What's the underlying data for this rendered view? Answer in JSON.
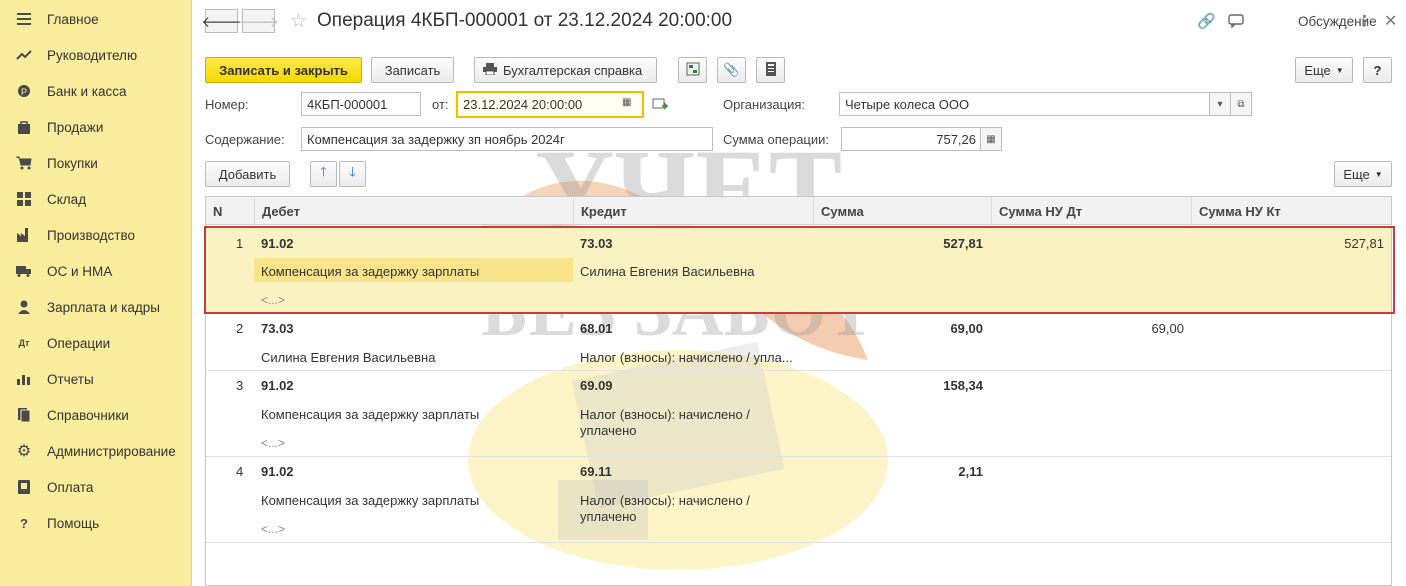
{
  "sidebar": {
    "items": [
      {
        "label": "Главное",
        "icon": "menu-icon"
      },
      {
        "label": "Руководителю",
        "icon": "trend-icon"
      },
      {
        "label": "Банк и касса",
        "icon": "coins-icon"
      },
      {
        "label": "Продажи",
        "icon": "bag-icon"
      },
      {
        "label": "Покупки",
        "icon": "cart-icon"
      },
      {
        "label": "Склад",
        "icon": "warehouse-icon"
      },
      {
        "label": "Производство",
        "icon": "factory-icon"
      },
      {
        "label": "ОС и НМА",
        "icon": "truck-icon"
      },
      {
        "label": "Зарплата и кадры",
        "icon": "person-icon"
      },
      {
        "label": "Операции",
        "icon": "operations-icon"
      },
      {
        "label": "Отчеты",
        "icon": "bar-chart-icon"
      },
      {
        "label": "Справочники",
        "icon": "books-icon"
      },
      {
        "label": "Администрирование",
        "icon": "gear-icon"
      },
      {
        "label": "Оплата",
        "icon": "payment-icon"
      },
      {
        "label": "Помощь",
        "icon": "help-icon"
      }
    ]
  },
  "header": {
    "title": "Операция 4КБП-000001 от 23.12.2024 20:00:00",
    "discuss_label": "Обсуждение"
  },
  "toolbar": {
    "save_close": "Записать и закрыть",
    "save": "Записать",
    "report": "Бухгалтерская справка",
    "more": "Еще",
    "help": "?"
  },
  "form": {
    "number_label": "Номер:",
    "number_value": "4КБП-000001",
    "date_label": "от:",
    "date_value": "23.12.2024 20:00:00",
    "org_label": "Организация:",
    "org_value": "Четыре колеса ООО",
    "content_label": "Содержание:",
    "content_value": "Компенсация за задержку зп ноябрь 2024г",
    "sum_label": "Сумма операции:",
    "sum_value": "757,26"
  },
  "table_toolbar": {
    "add": "Добавить",
    "more": "Еще"
  },
  "table": {
    "headers": [
      "N",
      "Дебет",
      "Кредит",
      "Сумма",
      "Сумма НУ Дт",
      "Сумма НУ Кт"
    ],
    "rows": [
      {
        "n": "1",
        "debit": "91.02",
        "debit_sub": "Компенсация за задержку зарплаты",
        "debit_sub2": "<...>",
        "credit": "73.03",
        "credit_sub": "Силина Евгения Васильевна",
        "credit_sub2": "",
        "sum": "527,81",
        "nu_dt": "",
        "nu_kt": "527,81"
      },
      {
        "n": "2",
        "debit": "73.03",
        "debit_sub": "Силина Евгения Васильевна",
        "debit_sub2": "",
        "credit": "68.01",
        "credit_sub": "Налог (взносы): начислено / упла...",
        "credit_sub2": "",
        "sum": "69,00",
        "nu_dt": "69,00",
        "nu_kt": ""
      },
      {
        "n": "3",
        "debit": "91.02",
        "debit_sub": "Компенсация за задержку зарплаты",
        "debit_sub2": "<...>",
        "credit": "69.09",
        "credit_sub": "Налог (взносы): начислено /",
        "credit_sub2": "уплачено",
        "sum": "158,34",
        "nu_dt": "",
        "nu_kt": ""
      },
      {
        "n": "4",
        "debit": "91.02",
        "debit_sub": "Компенсация за задержку зарплаты",
        "debit_sub2": "<...>",
        "credit": "69.11",
        "credit_sub": "Налог (взносы): начислено /",
        "credit_sub2": "уплачено",
        "sum": "2,11",
        "nu_dt": "",
        "nu_kt": ""
      }
    ]
  },
  "watermark": {
    "line1": "УЧЕТ",
    "line2": "БЕЗ ЗАБОТ"
  }
}
